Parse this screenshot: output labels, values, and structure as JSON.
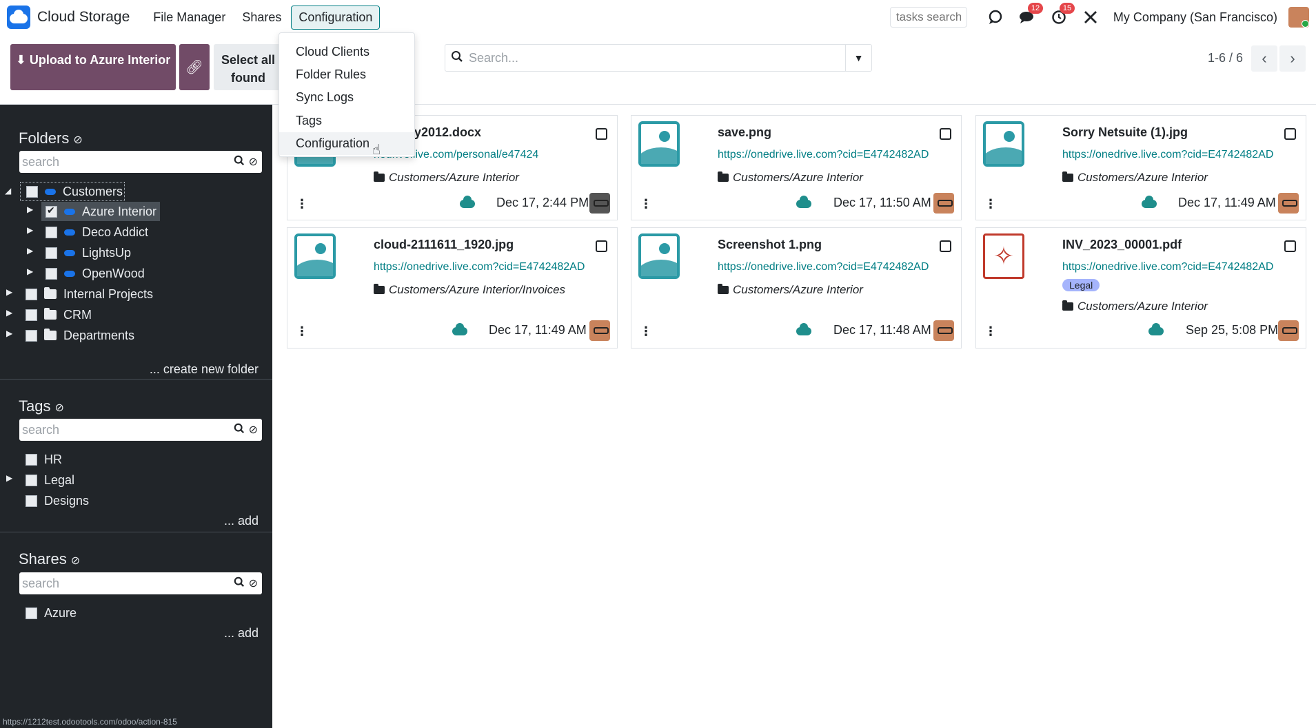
{
  "app": {
    "brand": "Cloud Storage",
    "menu": [
      "File Manager",
      "Shares",
      "Configuration"
    ],
    "tasks_search_placeholder": "tasks search",
    "messages_badge": "12",
    "activities_badge": "15",
    "company": "My Company (San Francisco)"
  },
  "dropdown": {
    "items": [
      "Cloud Clients",
      "Folder Rules",
      "Sync Logs",
      "Tags",
      "Configuration"
    ]
  },
  "control_panel": {
    "upload_label": "Upload to Azure Interior",
    "select_label": "Select all found",
    "search_placeholder": "Search...",
    "pager": "1-6 / 6"
  },
  "sidebar": {
    "folders": {
      "title": "Folders",
      "search_placeholder": "search",
      "items": [
        {
          "label": "Customers"
        },
        {
          "label": "Azure Interior"
        },
        {
          "label": "Deco Addict"
        },
        {
          "label": "LightsUp"
        },
        {
          "label": "OpenWood"
        },
        {
          "label": "Internal Projects"
        },
        {
          "label": "CRM"
        },
        {
          "label": "Departments"
        }
      ],
      "create_link": "... create new folder"
    },
    "tags": {
      "title": "Tags",
      "search_placeholder": "search",
      "items": [
        "HR",
        "Legal",
        "Designs"
      ],
      "add_link": "... add"
    },
    "shares": {
      "title": "Shares",
      "search_placeholder": "search",
      "items": [
        "Azure"
      ],
      "add_link": "... add"
    },
    "status_url": "https://1212test.odootools.com/odoo/action-815"
  },
  "cards": [
    {
      "title": "ompany2012.docx",
      "url": "nedrive.live.com/personal/e47424",
      "path": "Customers/Azure Interior",
      "date": "Dec 17, 2:44 PM"
    },
    {
      "title": "save.png",
      "url": "https://onedrive.live.com?cid=E4742482AD",
      "path": "Customers/Azure Interior",
      "date": "Dec 17, 11:50 AM"
    },
    {
      "title": "Sorry Netsuite (1).jpg",
      "url": "https://onedrive.live.com?cid=E4742482AD",
      "path": "Customers/Azure Interior",
      "date": "Dec 17, 11:49 AM"
    },
    {
      "title": "cloud-2111611_1920.jpg",
      "url": "https://onedrive.live.com?cid=E4742482AD",
      "path": "Customers/Azure Interior/Invoices",
      "date": "Dec 17, 11:49 AM"
    },
    {
      "title": "Screenshot 1.png",
      "url": "https://onedrive.live.com?cid=E4742482AD",
      "path": "Customers/Azure Interior",
      "date": "Dec 17, 11:48 AM"
    },
    {
      "title": "INV_2023_00001.pdf",
      "url": "https://onedrive.live.com?cid=E4742482AD",
      "tag": "Legal",
      "path": "Customers/Azure Interior",
      "date": "Sep 25, 5:08 PM"
    }
  ],
  "colors": {
    "primary": "#714b67",
    "accent": "#017e84",
    "sidebar_bg": "#212529",
    "badge": "#e5464a"
  }
}
